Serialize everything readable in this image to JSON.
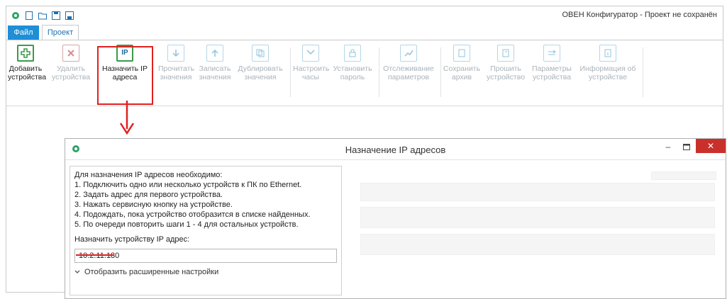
{
  "window": {
    "title": "ОВЕН Конфигуратор - Проект не сохранён"
  },
  "tabs": [
    {
      "label": "Файл"
    },
    {
      "label": "Проект"
    }
  ],
  "ribbon": {
    "buttons": [
      {
        "label": "Добавить\nустройства",
        "enabled": true,
        "icon": "add-device-icon"
      },
      {
        "label": "Удалить\nустройства",
        "enabled": false,
        "icon": "delete-device-icon"
      },
      {
        "label": "Назначить IP\nадреса",
        "enabled": true,
        "icon": "assign-ip-icon",
        "icon_text": "IP"
      },
      {
        "label": "Прочитать\nзначения",
        "enabled": false,
        "icon": "read-values-icon"
      },
      {
        "label": "Записать\nзначения",
        "enabled": false,
        "icon": "write-values-icon"
      },
      {
        "label": "Дублировать\nзначения",
        "enabled": false,
        "icon": "duplicate-values-icon"
      },
      {
        "label": "Настроить\nчасы",
        "enabled": false,
        "icon": "clock-icon"
      },
      {
        "label": "Установить\nпароль",
        "enabled": false,
        "icon": "password-icon"
      },
      {
        "label": "Отслеживание\nпараметров",
        "enabled": false,
        "icon": "monitor-params-icon"
      },
      {
        "label": "Сохранить\nархив",
        "enabled": false,
        "icon": "save-archive-icon"
      },
      {
        "label": "Прошить\nустройство",
        "enabled": false,
        "icon": "flash-device-icon"
      },
      {
        "label": "Параметры\nустройства",
        "enabled": false,
        "icon": "device-params-icon"
      },
      {
        "label": "Информация об\nустройстве",
        "enabled": false,
        "icon": "device-info-icon"
      }
    ]
  },
  "dialog": {
    "title": "Назначение IP адресов",
    "instructions": [
      "Для назначения IP адресов необходимо:",
      "1. Подключить одно или несколько устройств к ПК по Ethernet.",
      "2. Задать адрес для первого устройства.",
      "3. Нажать сервисную кнопку на устройстве.",
      "4. Подождать, пока устройство отобразится в списке найденных.",
      "5. По очереди повторить шаги 1 - 4 для остальных устройств."
    ],
    "assign_label": "Назначить устройству IP адрес:",
    "ip_value": "10.2.11.180",
    "advanced_label": "Отобразить расширенные настройки"
  },
  "colors": {
    "accent": "#1e8fd6",
    "highlight": "#e02020",
    "close": "#c9302c"
  }
}
